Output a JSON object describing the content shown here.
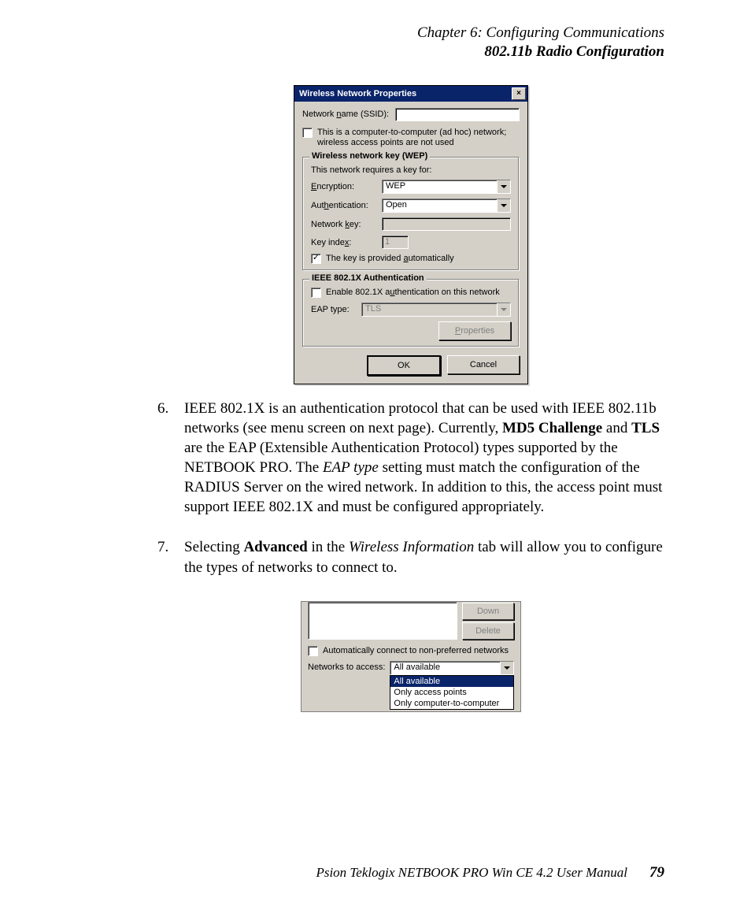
{
  "header": {
    "chapter": "Chapter 6:  Configuring Communications",
    "section": "802.11b Radio Configuration"
  },
  "dialog1": {
    "title": "Wireless Network Properties",
    "ssid_label_pre": "Network ",
    "ssid_label_u": "n",
    "ssid_label_post": "ame (SSID):",
    "adhoc_checked": false,
    "adhoc_text": "This is a computer-to-computer (ad hoc) network; wireless access points are not used",
    "group_wep": {
      "title": "Wireless network key (WEP)",
      "requires": "This network requires a key for:",
      "encryption_label_u": "E",
      "encryption_label_post": "ncryption:",
      "encryption_value": "WEP",
      "auth_label_pre": "Aut",
      "auth_label_u": "h",
      "auth_label_post": "entication:",
      "auth_value": "Open",
      "netkey_label_pre": "Network ",
      "netkey_label_u": "k",
      "netkey_label_post": "ey:",
      "keyidx_label_pre": "Key inde",
      "keyidx_label_u": "x",
      "keyidx_label_post": ":",
      "keyidx_value": "1",
      "auto_checked": true,
      "auto_label_pre": "The key is provided ",
      "auto_label_u": "a",
      "auto_label_post": "utomatically"
    },
    "group_8021x": {
      "title": "IEEE 802.1X Authentication",
      "enable_checked": false,
      "enable_label_pre": "Enable 802.1X a",
      "enable_label_u": "u",
      "enable_label_post": "thentication on this network",
      "eap_label": "EAP type:",
      "eap_value": "TLS",
      "properties_btn_u": "P",
      "properties_btn_post": "roperties"
    },
    "ok": "OK",
    "cancel": "Cancel"
  },
  "para6": {
    "num": "6.",
    "t1": "IEEE 802.1X is an authentication protocol that can be used with IEEE 802.11b networks (see menu screen on next page). Currently, ",
    "b1": "MD5 Challenge",
    "t2": " and ",
    "b2": "TLS",
    "t3": " are the EAP (Extensible Authentication Protocol) types supported by the NETBOOK PRO. The ",
    "i1": "EAP type",
    "t4": " setting must match the configuration of the RADIUS Server on the wired network. In addition to this, the access point must support IEEE 802.1X and must be configured appropriately."
  },
  "para7": {
    "num": "7.",
    "t1": "Selecting ",
    "b1": "Advanced",
    "t2": " in the ",
    "i1": "Wireless Information",
    "t3": " tab will allow you to configure the types of networks to connect to."
  },
  "dialog2": {
    "btn_down": "Down",
    "btn_delete": "Delete",
    "autochk_checked": false,
    "autochk_label": "Automatically connect to non-preferred networks",
    "networks_label": "Networks to access:",
    "combo_value": "All available",
    "options": [
      "All available",
      "Only access points",
      "Only computer-to-computer"
    ],
    "selected_index": 0
  },
  "footer": {
    "line": "Psion Teklogix NETBOOK PRO Win CE 4.2 User Manual",
    "page": "79"
  }
}
